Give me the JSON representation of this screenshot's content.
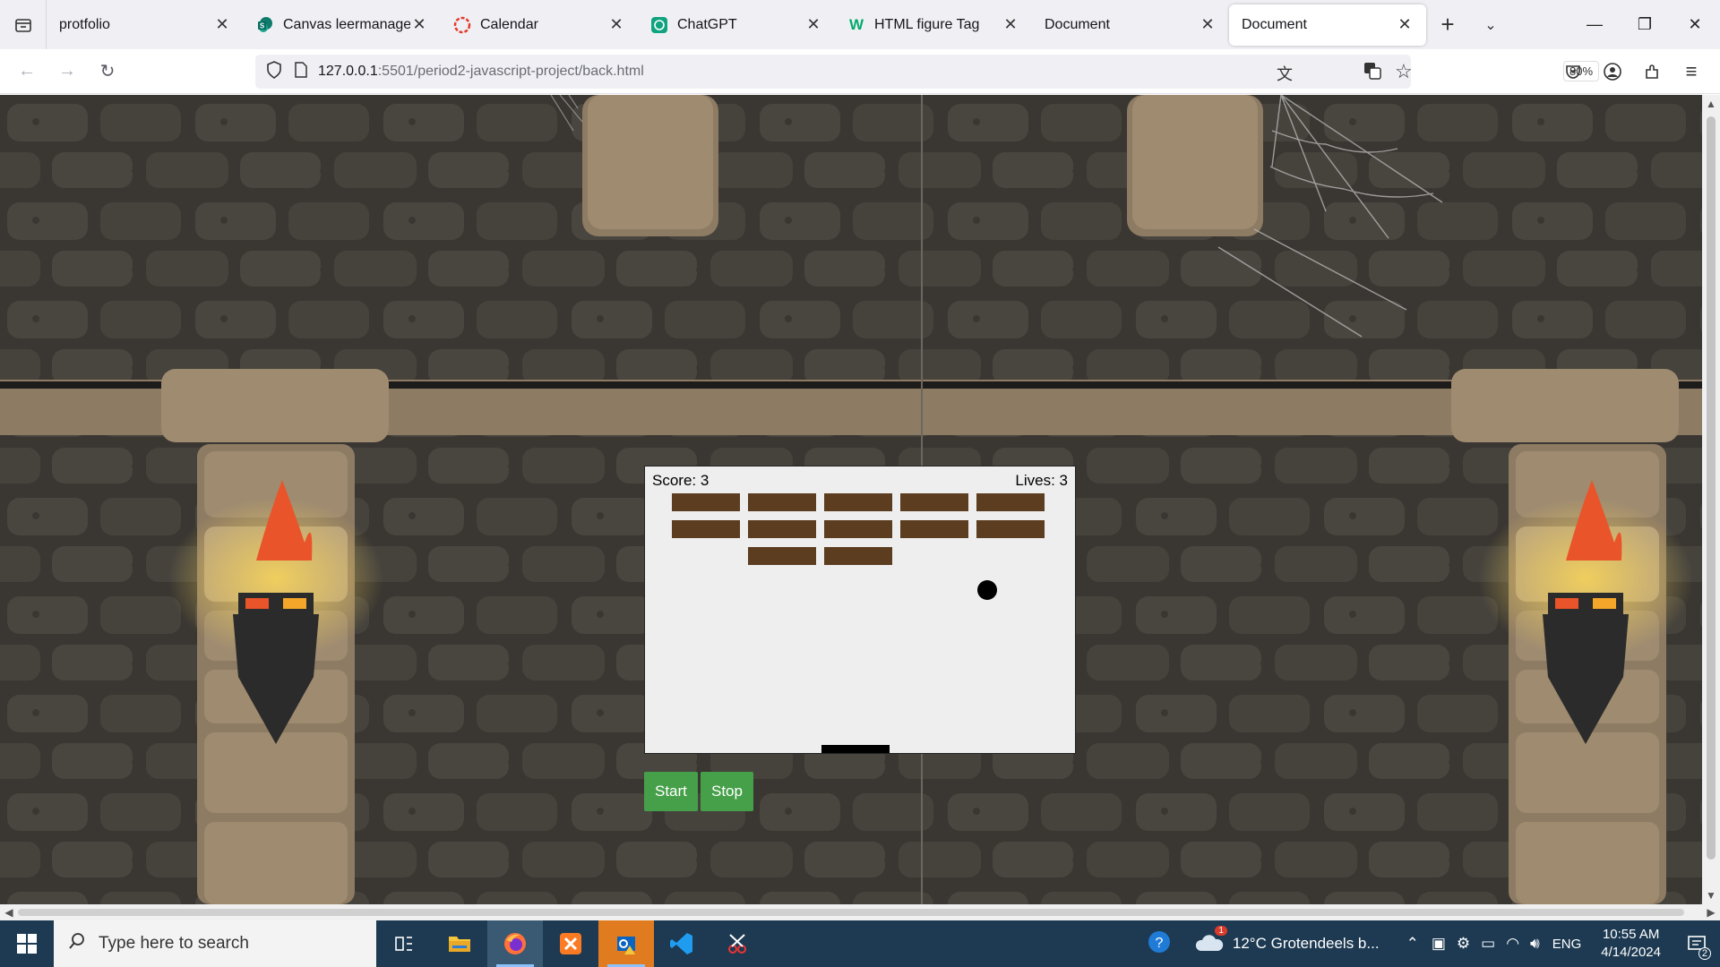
{
  "browser": {
    "tabs": [
      {
        "title": "protfolio",
        "icon": "none"
      },
      {
        "title": "Canvas leermanagem",
        "icon": "sharepoint-icon",
        "color": "#0f7b6c"
      },
      {
        "title": "Calendar",
        "icon": "calendar-icon",
        "color": "#e33b2e"
      },
      {
        "title": "ChatGPT",
        "icon": "chatgpt-icon",
        "color": "#10a37f"
      },
      {
        "title": "HTML figure Tag",
        "icon": "w3schools-icon",
        "color": "#04aa6d"
      },
      {
        "title": "Document",
        "icon": "none"
      },
      {
        "title": "Document",
        "icon": "none",
        "active": true
      }
    ],
    "url_host": "127.0.0.1",
    "url_rest": ":5501/period2-javascript-project/back.html",
    "zoom": "80%"
  },
  "game": {
    "score_label": "Score: 3",
    "lives_label": "Lives: 3",
    "bricks": {
      "rows": [
        [
          true,
          true,
          true,
          true,
          true
        ],
        [
          true,
          true,
          true,
          true,
          true
        ],
        [
          false,
          true,
          true,
          false,
          false
        ]
      ]
    },
    "start_label": "Start",
    "stop_label": "Stop"
  },
  "taskbar": {
    "search_placeholder": "Type here to search",
    "weather": "12°C  Grotendeels b...",
    "lang": "ENG",
    "time": "10:55 AM",
    "date": "4/14/2024",
    "notification_count": "2",
    "weather_badge": "1"
  },
  "colors": {
    "brick": "#5c3d20",
    "button": "#46a049",
    "wall": "#3a3732",
    "taskbar": "#1d3a52"
  }
}
